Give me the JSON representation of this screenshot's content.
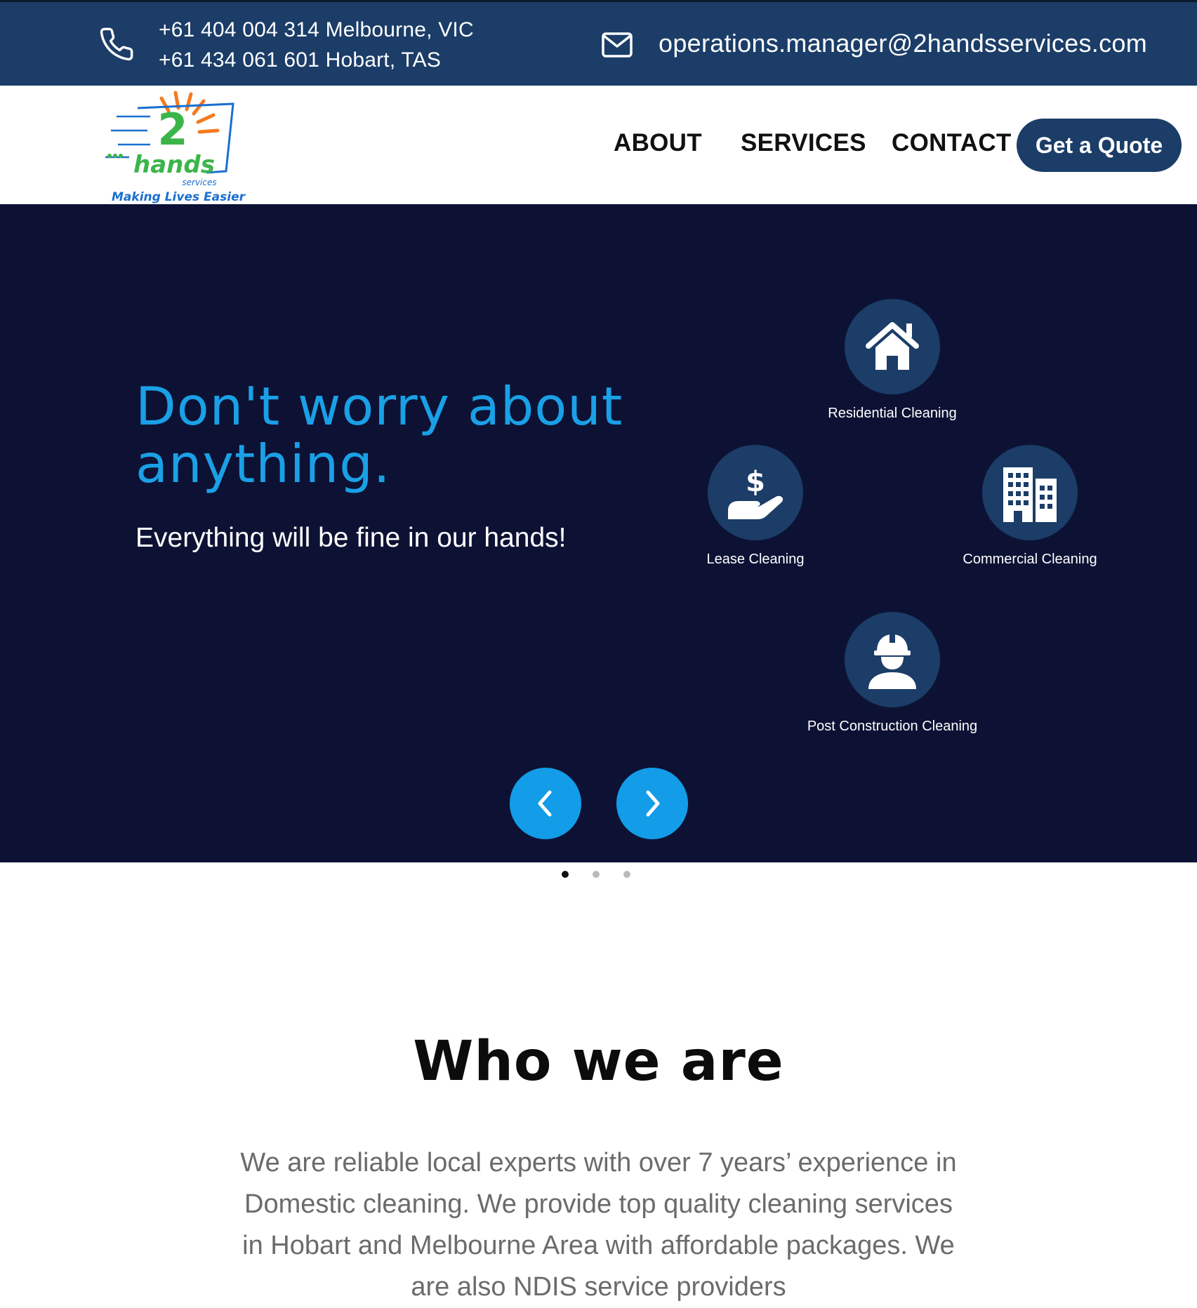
{
  "topbar": {
    "phone_lines": [
      "+61 404 004 314 Melbourne, VIC",
      "+61 434 061 601 Hobart, TAS"
    ],
    "email": "operations.manager@2handsservices.com"
  },
  "logo": {
    "numeral": "2",
    "word": "hands",
    "small": "services",
    "tagline": "Making Lives Easier"
  },
  "nav": {
    "items": [
      "ABOUT",
      "SERVICES",
      "CONTACT"
    ],
    "cta": "Get a Quote"
  },
  "hero": {
    "title": "Don't worry about anything.",
    "subtitle": "Everything will be fine in our hands!",
    "services": [
      {
        "label": "Residential Cleaning",
        "icon": "house-icon"
      },
      {
        "label": "Lease Cleaning",
        "icon": "hand-dollar-icon"
      },
      {
        "label": "Commercial Cleaning",
        "icon": "building-icon"
      },
      {
        "label": "Post Construction Cleaning",
        "icon": "worker-hardhat-icon"
      }
    ],
    "slides": {
      "count": 3,
      "active": 1
    }
  },
  "who": {
    "title": "Who we are",
    "text": "We are reliable local experts with over 7 years’ experience in Domestic cleaning. We provide top quality cleaning services in Hobart and Melbourne Area with affordable packages. We are also NDIS service providers"
  },
  "colors": {
    "topbar": "#1b3d68",
    "hero_bg": "#0d1234",
    "accent_blue": "#1aa0e6",
    "arrow_blue": "#139ce8",
    "icon_circle": "#1b3d68"
  }
}
